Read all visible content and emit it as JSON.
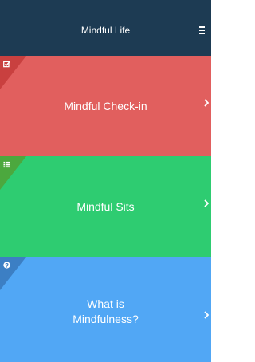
{
  "header": {
    "title": "Mindful Life",
    "menu_icon": "hamburger-menu-icon"
  },
  "tiles": [
    {
      "label": "Mindful Check-in",
      "color": "#e15f5e",
      "corner_color": "#c9403f",
      "icon": "checkbox-edit-icon"
    },
    {
      "label": "Mindful Sits",
      "color": "#2ecc71",
      "corner_color": "#4ca83e",
      "icon": "list-icon"
    },
    {
      "label": "What is\nMindfulness?",
      "color": "#51a7f5",
      "corner_color": "#3c7fc4",
      "icon": "question-circle-icon"
    }
  ],
  "colors": {
    "header_bg": "#1d3b53",
    "text": "#ffffff"
  }
}
